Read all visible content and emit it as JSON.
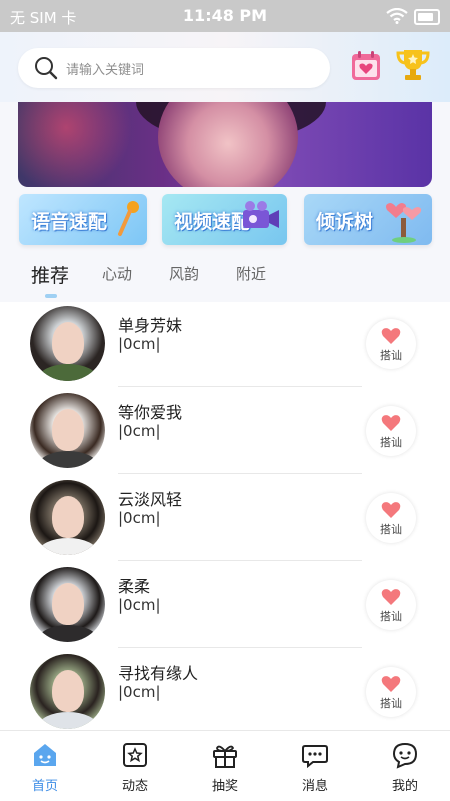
{
  "status_bar": {
    "carrier": "无 SIM 卡",
    "time": "11:48 PM"
  },
  "search": {
    "placeholder": "请输入关键词"
  },
  "quick_actions": [
    {
      "label": "语音速配"
    },
    {
      "label": "视频速配"
    },
    {
      "label": "倾诉树"
    }
  ],
  "tabs": [
    {
      "label": "推荐",
      "active": true
    },
    {
      "label": "心动"
    },
    {
      "label": "风韵"
    },
    {
      "label": "附近"
    }
  ],
  "users": [
    {
      "name": "单身芳妹",
      "height": "|0cm|",
      "action": "搭讪"
    },
    {
      "name": "等你爱我",
      "height": "|0cm|",
      "action": "搭讪"
    },
    {
      "name": "云淡风轻",
      "height": "|0cm|",
      "action": "搭讪"
    },
    {
      "name": "柔柔",
      "height": "|0cm|",
      "action": "搭讪"
    },
    {
      "name": "寻找有缘人",
      "height": "|0cm|",
      "action": "搭讪"
    }
  ],
  "bottom_nav": [
    {
      "label": "首页",
      "icon": "home-icon",
      "active": true
    },
    {
      "label": "动态",
      "icon": "star-square-icon"
    },
    {
      "label": "抽奖",
      "icon": "gift-icon"
    },
    {
      "label": "消息",
      "icon": "chat-bubble-icon"
    },
    {
      "label": "我的",
      "icon": "smiley-bubble-icon"
    }
  ],
  "colors": {
    "accent": "#3e8de6",
    "heart": "#f4787c"
  }
}
